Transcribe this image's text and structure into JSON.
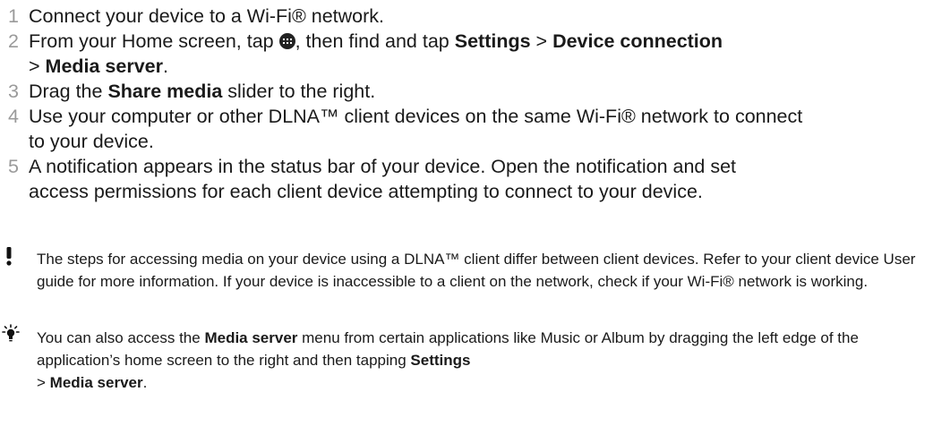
{
  "steps": [
    {
      "num": "1",
      "parts": [
        {
          "t": "Connect your device to a Wi-Fi® network."
        }
      ]
    },
    {
      "num": "2",
      "parts": [
        {
          "t": "From your Home screen, tap "
        },
        {
          "icon": "apps-icon"
        },
        {
          "t": ", then find and tap "
        },
        {
          "b": "Settings"
        },
        {
          "t": " > "
        },
        {
          "b": "Device connection"
        },
        {
          "t": " > "
        },
        {
          "b": "Media server"
        },
        {
          "t": "."
        }
      ]
    },
    {
      "num": "3",
      "parts": [
        {
          "t": "Drag the "
        },
        {
          "b": "Share media"
        },
        {
          "t": " slider to the right."
        }
      ]
    },
    {
      "num": "4",
      "parts": [
        {
          "t": "Use your computer or other DLNA™ client devices on the same Wi-Fi® network to connect to your device."
        }
      ]
    },
    {
      "num": "5",
      "parts": [
        {
          "t": "A notification appears in the status bar of your device. Open the notification and set access permissions for each client device attempting to connect to your device."
        }
      ]
    }
  ],
  "warning": {
    "icon": "exclamation-icon",
    "parts": [
      {
        "t": "The steps for accessing media on your device using a DLNA™ client differ between client devices. Refer to your client device User guide for more information. If your device is inaccessible to a client on the network, check if your Wi-Fi® network is working."
      }
    ]
  },
  "tip": {
    "icon": "lightbulb-icon",
    "parts": [
      {
        "t": "You can also access the "
      },
      {
        "b": "Media server"
      },
      {
        "t": " menu from certain applications like Music or Album by dragging the left edge of the application’s home screen to the right and then tapping "
      },
      {
        "b": "Settings"
      },
      {
        "t": " > "
      },
      {
        "b": "Media server"
      },
      {
        "t": "."
      }
    ]
  }
}
